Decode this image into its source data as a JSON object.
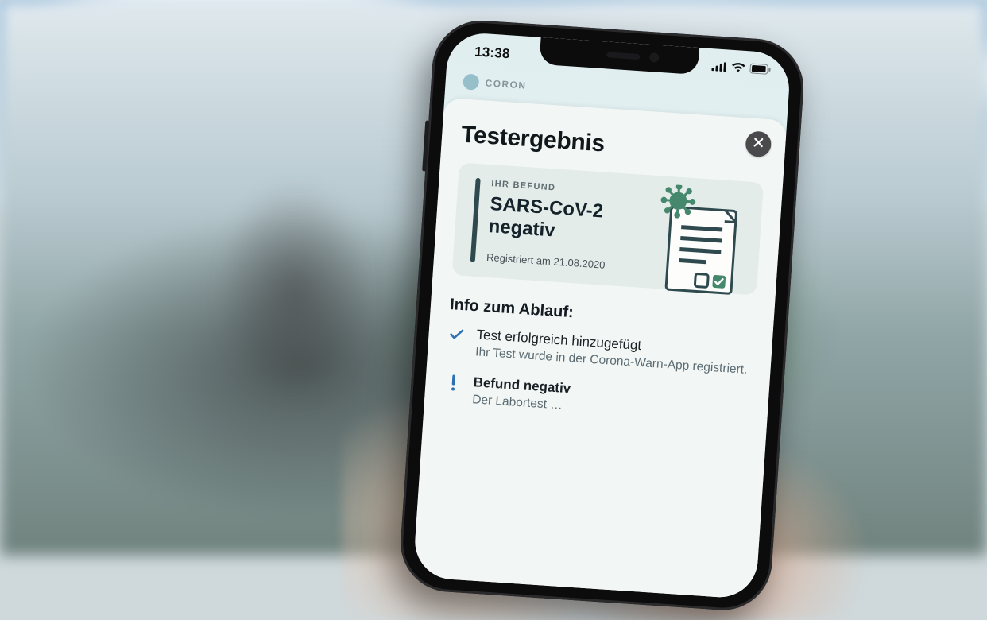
{
  "statusbar": {
    "time": "13:38"
  },
  "app_header": {
    "brand_partial": "CORON"
  },
  "panel": {
    "title": "Testergebnis",
    "close_aria": "Schließen"
  },
  "result": {
    "label": "IHR BEFUND",
    "status_line1": "SARS-CoV-2",
    "status_line2": "negativ",
    "registered_prefix": "Registriert am",
    "registered_date": "21.08.2020"
  },
  "info": {
    "heading": "Info zum Ablauf:",
    "items": [
      {
        "icon": "check",
        "title": "Test erfolgreich hinzugefügt",
        "desc": "Ihr Test wurde in der Corona-Warn-App registriert."
      },
      {
        "icon": "bang",
        "title": "Befund negativ",
        "desc": "Der Labortest …"
      }
    ]
  }
}
